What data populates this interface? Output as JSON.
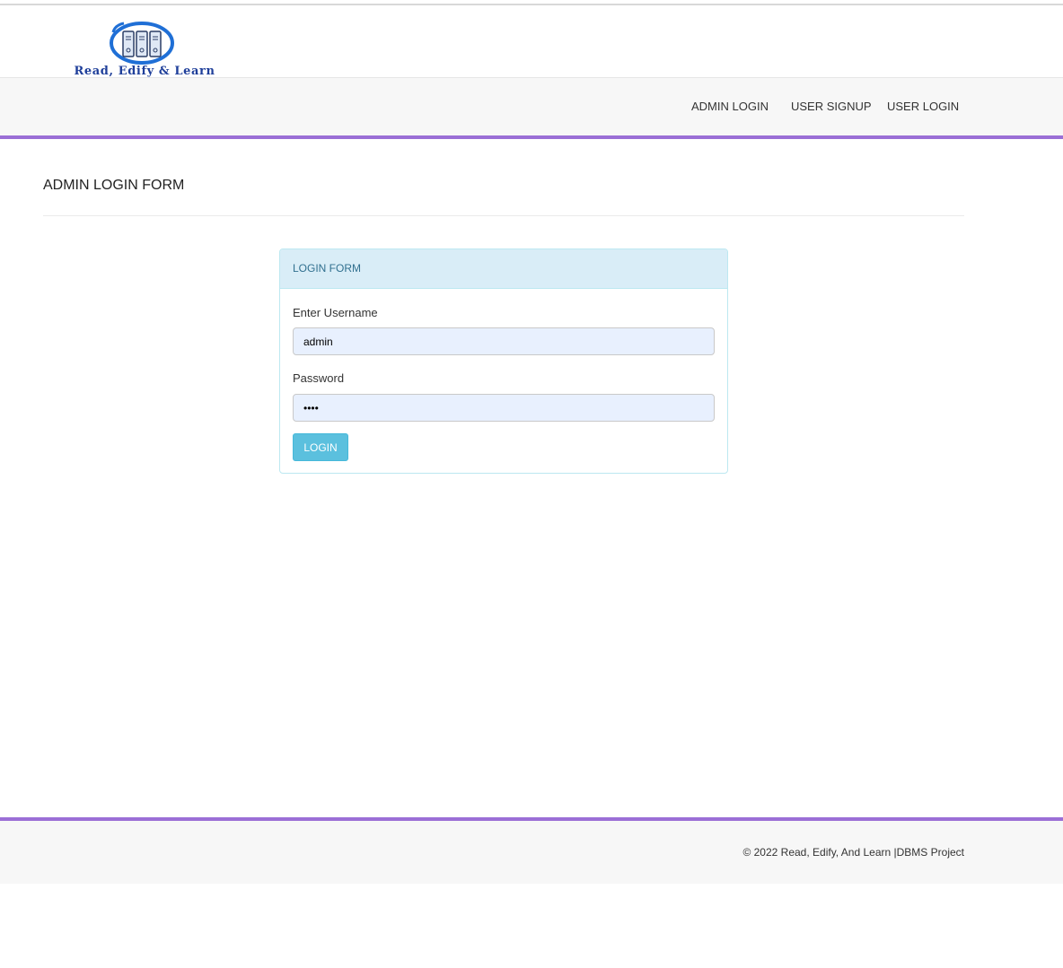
{
  "brand": {
    "logo_text": "Read, Edify & Learn",
    "logo_icon": "books-icon",
    "accent_color": "#9b6fd6",
    "logo_color": "#1f6fd6"
  },
  "nav": {
    "items": [
      {
        "label": "ADMIN LOGIN"
      },
      {
        "label": "USER SIGNUP"
      },
      {
        "label": "USER LOGIN"
      }
    ]
  },
  "page": {
    "title": "ADMIN LOGIN FORM"
  },
  "form": {
    "heading": "LOGIN FORM",
    "username_label": "Enter Username",
    "username_value": "admin",
    "password_label": "Password",
    "password_value": "••••",
    "login_button": "LOGIN"
  },
  "footer": {
    "text": "© 2022 Read, Edify, And Learn |DBMS Project"
  }
}
